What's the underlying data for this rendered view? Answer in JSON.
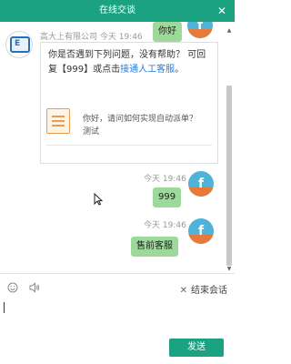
{
  "window": {
    "title": "在线交谈"
  },
  "top_bubble": {
    "text": "你好"
  },
  "agent": {
    "name_time": "高大上有限公司 今天 19:46"
  },
  "card": {
    "line1": "你是否遇到下列问题，没有帮助？ 可回复【999】或点击",
    "link": "接通人工客服",
    "tail": "。",
    "faq_line1": "你好，请问如何实现自动派单？",
    "faq_line2": "测试"
  },
  "messages": [
    {
      "time": "今天 19:46",
      "text": "999"
    },
    {
      "time": "今天 19:46",
      "text": "售前客服"
    }
  ],
  "toolbar": {
    "end_label": "结束会话"
  },
  "input": {
    "value": ""
  },
  "send_label": "发送",
  "colors": {
    "brand": "#1aa281",
    "bubble": "#9dd99a",
    "link": "#2a7be0"
  }
}
